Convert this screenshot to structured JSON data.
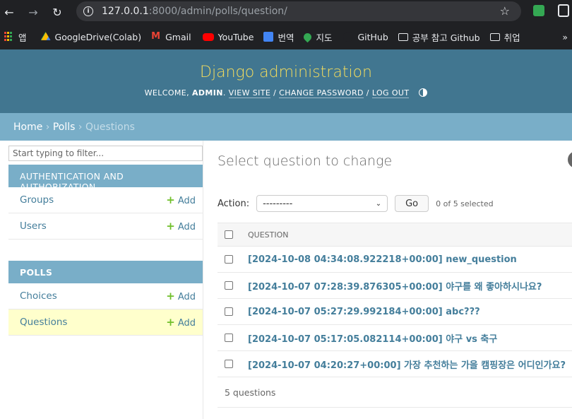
{
  "browser": {
    "url_host": "127.0.0.1",
    "url_path": ":8000/admin/polls/question/",
    "bookmarks": [
      "앱",
      "GoogleDrive(Colab)",
      "Gmail",
      "YouTube",
      "번역",
      "지도",
      "GitHub",
      "공부 참고 Github",
      "취업"
    ],
    "more": "»"
  },
  "header": {
    "branding": "Django administration",
    "welcome": "WELCOME,",
    "user": "ADMIN",
    "view_site": "VIEW SITE",
    "change_password": "CHANGE PASSWORD",
    "log_out": "LOG OUT"
  },
  "breadcrumbs": {
    "home": "Home",
    "app": "Polls",
    "current": "Questions",
    "sep": "›"
  },
  "sidebar": {
    "filter_placeholder": "Start typing to filter...",
    "modules": [
      {
        "caption": "AUTHENTICATION AND AUTHORIZATION",
        "models": [
          {
            "name": "Groups",
            "add": "Add"
          },
          {
            "name": "Users",
            "add": "Add"
          }
        ]
      },
      {
        "caption": "POLLS",
        "models": [
          {
            "name": "Choices",
            "add": "Add"
          },
          {
            "name": "Questions",
            "add": "Add"
          }
        ]
      }
    ]
  },
  "content": {
    "title": "Select question to change",
    "action_label": "Action:",
    "action_value": "---------",
    "go": "Go",
    "selected": "0 of 5 selected",
    "column": "QUESTION",
    "rows": [
      "[2024-10-08 04:34:08.922218+00:00] new_question",
      "[2024-10-07 07:28:39.876305+00:00] 야구를 왜 좋아하시나요?",
      "[2024-10-07 05:27:29.992184+00:00] abc???",
      "[2024-10-07 05:17:05.082114+00:00] 야구 vs 축구",
      "[2024-10-07 04:20:27+00:00] 가장 추천하는 가을 캠핑장은 어디인가요?"
    ],
    "count": "5 questions"
  }
}
